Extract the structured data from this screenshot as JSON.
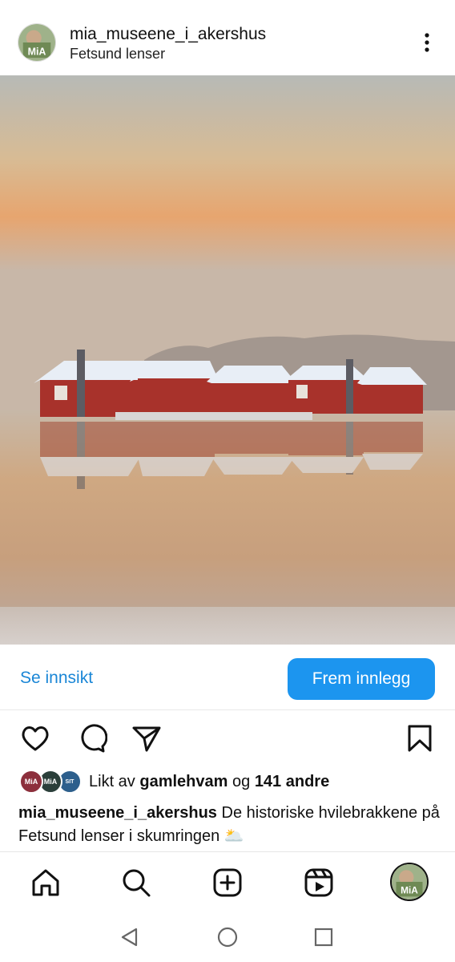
{
  "post": {
    "username": "mia_museene_i_akershus",
    "location": "Fetsund lenser",
    "avatar_text": "MiA",
    "image_alt": "photo"
  },
  "insight": {
    "link_label": "Se innsikt",
    "promote_label": "Frem innlegg"
  },
  "actions": {
    "icons": [
      "heart-icon",
      "comment-icon",
      "share-icon",
      "bookmark-icon"
    ]
  },
  "likes": {
    "prefix": "Likt av",
    "user": "gamlehvam",
    "joiner": "og",
    "others": "141 andre",
    "avatars": [
      "MiA",
      "MiA",
      "SIT"
    ]
  },
  "caption": {
    "username": "mia_museene_i_akershus",
    "text": "De historiske hvilebrakkene på Fetsund lenser i skumringen",
    "emoji": "🌥️"
  },
  "bottom_nav": {
    "items": [
      "home-icon",
      "search-icon",
      "create-icon",
      "reels-icon",
      "profile-avatar"
    ]
  },
  "system_nav": {
    "items": [
      "back-icon",
      "home-circle-icon",
      "recents-icon"
    ]
  },
  "colors": {
    "accent": "#1c95ef",
    "link": "#1a86d6",
    "text": "#111111"
  }
}
